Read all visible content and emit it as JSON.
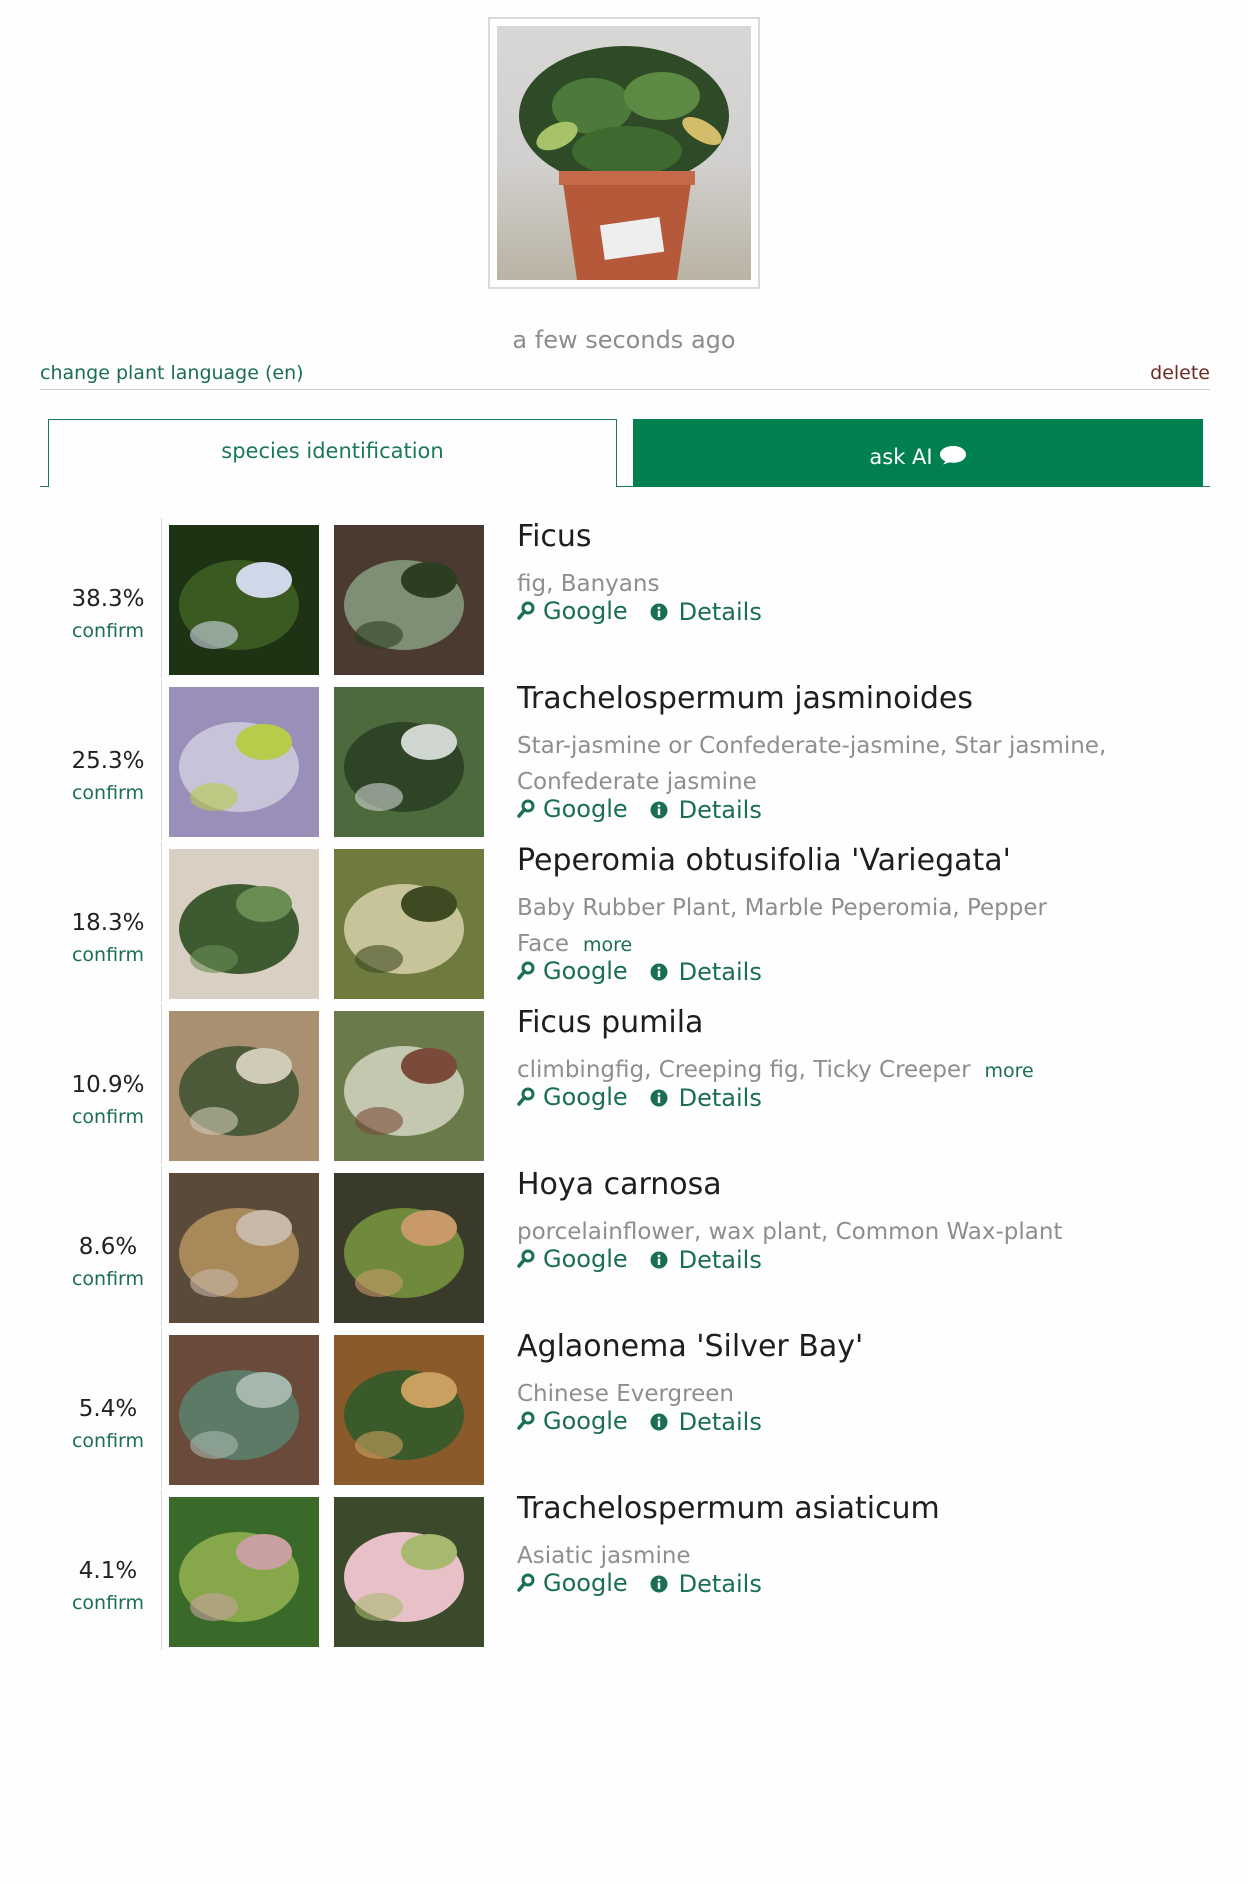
{
  "header": {
    "timestamp": "a few seconds ago",
    "change_language": "change plant language (en)",
    "delete": "delete"
  },
  "tabs": {
    "species_identification": "species identification",
    "ask_ai": "ask AI"
  },
  "labels": {
    "confirm": "confirm",
    "google": "Google",
    "details": "Details",
    "more": "more"
  },
  "colors": {
    "accent": "#00804f",
    "link": "#1a6e52",
    "delete": "#6e2a20"
  },
  "results": [
    {
      "percent": "38.3%",
      "name": "Ficus",
      "common": "fig, Banyans",
      "more": false
    },
    {
      "percent": "25.3%",
      "name": "Trachelospermum jasminoides",
      "common": "Star-jasmine or Confederate-jasmine, Star jasmine, Confederate jasmine",
      "more": false
    },
    {
      "percent": "18.3%",
      "name": "Peperomia obtusifolia 'Variegata'",
      "common": "Baby Rubber Plant, Marble Peperomia, Pepper Face",
      "more": true
    },
    {
      "percent": "10.9%",
      "name": "Ficus pumila",
      "common": "climbingfig, Creeping fig, Ticky Creeper",
      "more": true
    },
    {
      "percent": "8.6%",
      "name": "Hoya carnosa",
      "common": "porcelainflower, wax plant, Common Wax-plant",
      "more": false
    },
    {
      "percent": "5.4%",
      "name": "Aglaonema 'Silver Bay'",
      "common": "Chinese Evergreen",
      "more": false
    },
    {
      "percent": "4.1%",
      "name": "Trachelospermum asiaticum",
      "common": "Asiatic jasmine",
      "more": false
    }
  ]
}
